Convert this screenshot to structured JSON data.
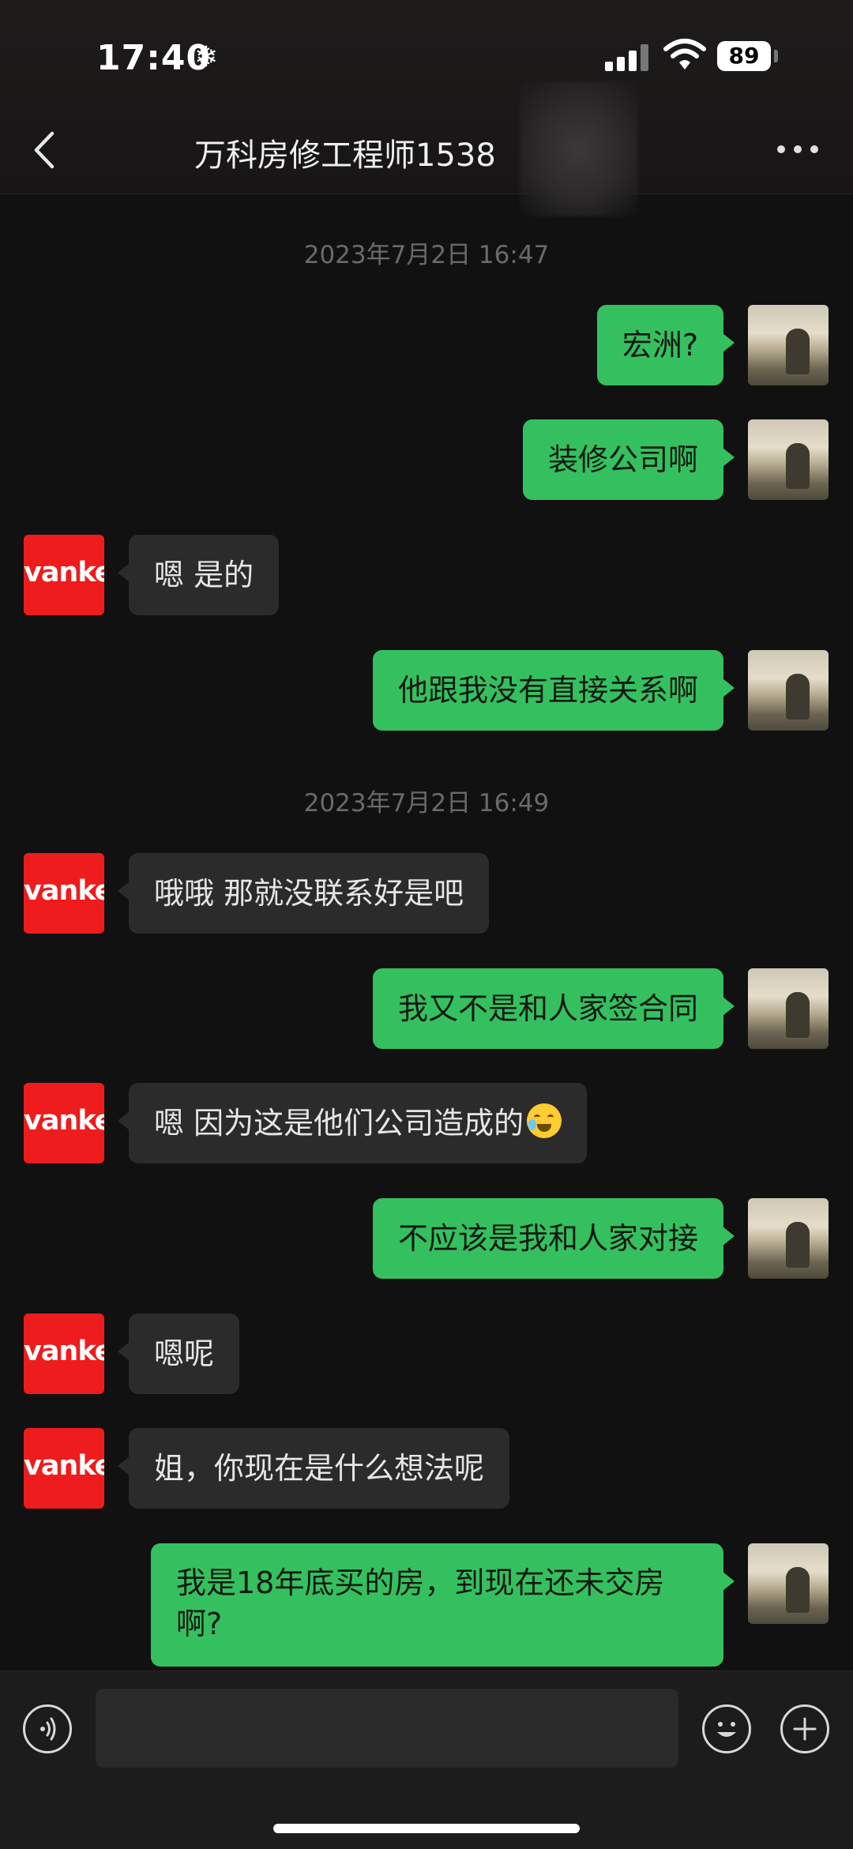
{
  "status_bar": {
    "time": "17:40",
    "time_icon": "snowflake-icon",
    "battery": "89"
  },
  "nav": {
    "title": "万科房修工程师1538",
    "back_icon": "chevron-left-icon",
    "more_icon": "more-dots-icon"
  },
  "chat": {
    "timestamps": [
      "2023年7月2日 16:47",
      "2023年7月2日 16:49"
    ],
    "messages": [
      {
        "from": "me",
        "text": "宏洲?"
      },
      {
        "from": "me",
        "text": "装修公司啊"
      },
      {
        "from": "vanke",
        "text": "嗯 是的"
      },
      {
        "from": "me",
        "text": "他跟我没有直接关系啊"
      },
      {
        "from": "vanke",
        "text": "哦哦 那就没联系好是吧"
      },
      {
        "from": "me",
        "text": "我又不是和人家签合同"
      },
      {
        "from": "vanke",
        "text": "嗯 因为这是他们公司造成的",
        "emoji": "sweat-smile-emoji"
      },
      {
        "from": "me",
        "text": "不应该是我和人家对接"
      },
      {
        "from": "vanke",
        "text": "嗯呢"
      },
      {
        "from": "vanke",
        "text": "姐，你现在是什么想法呢"
      },
      {
        "from": "me",
        "text": "我是18年底买的房，到现在还未交房啊?"
      }
    ],
    "vanke_avatar_text": "vanke"
  },
  "input_bar": {
    "voice_icon": "voice-icon",
    "emoji_icon": "emoji-icon",
    "plus_icon": "plus-icon",
    "value": ""
  },
  "colors": {
    "outgoing_bubble": "#35c05f",
    "incoming_bubble": "#2b2b2b",
    "vanke_red": "#ee1c1c",
    "background": "#111111"
  }
}
